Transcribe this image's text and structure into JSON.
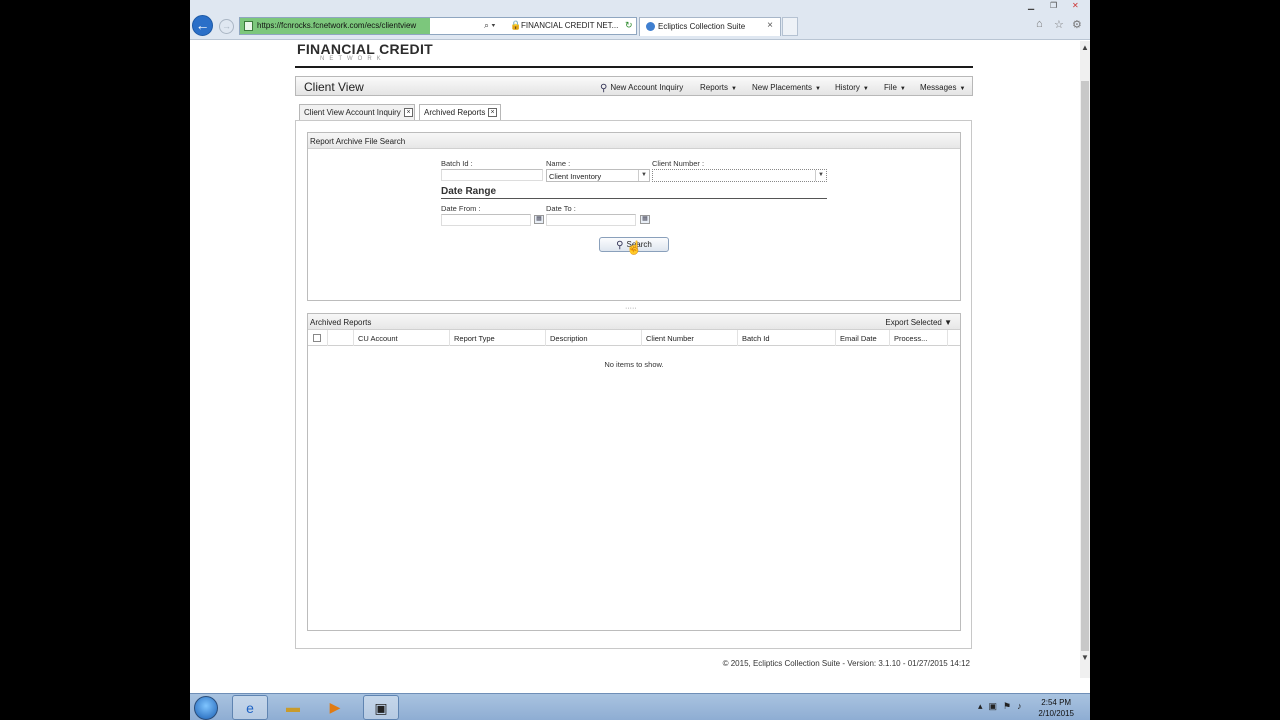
{
  "browser": {
    "url": "https://fcnrocks.fcnetwork.com/ecs/clientview",
    "site_label": "FINANCIAL CREDIT NET...",
    "tab_title": "Ecliptics Collection Suite"
  },
  "logo": {
    "main": "FINANCIAL CREDIT",
    "sub": "NETWORK"
  },
  "header": {
    "title": "Client View",
    "menu": [
      {
        "label": "New Account Inquiry",
        "icon": "magnifier-icon",
        "dropdown": false
      },
      {
        "label": "Reports",
        "dropdown": true
      },
      {
        "label": "New Placements",
        "dropdown": true
      },
      {
        "label": "History",
        "dropdown": true
      },
      {
        "label": "File",
        "dropdown": true
      },
      {
        "label": "Messages",
        "dropdown": true
      }
    ]
  },
  "tabs": [
    {
      "label": "Client View Account Inquiry",
      "active": false
    },
    {
      "label": "Archived Reports",
      "active": true
    }
  ],
  "search_panel": {
    "title": "Report Archive File Search",
    "batch_id_label": "Batch Id :",
    "batch_id_value": "",
    "name_label": "Name :",
    "name_value": "Client Inventory",
    "client_number_label": "Client Number :",
    "client_number_value": "",
    "date_range_title": "Date Range",
    "date_from_label": "Date From :",
    "date_from_value": "",
    "date_to_label": "Date To :",
    "date_to_value": "",
    "search_button": "Search"
  },
  "results_panel": {
    "title": "Archived Reports",
    "export_label": "Export Selected",
    "columns": [
      "CU Account",
      "Report Type",
      "Description",
      "Client Number",
      "Batch Id",
      "Email Date",
      "Process..."
    ],
    "empty_message": "No items to show."
  },
  "footer": "© 2015, Ecliptics Collection Suite - Version: 3.1.10 - 01/27/2015 14:12",
  "taskbar": {
    "time": "2:54 PM",
    "date": "2/10/2015"
  }
}
